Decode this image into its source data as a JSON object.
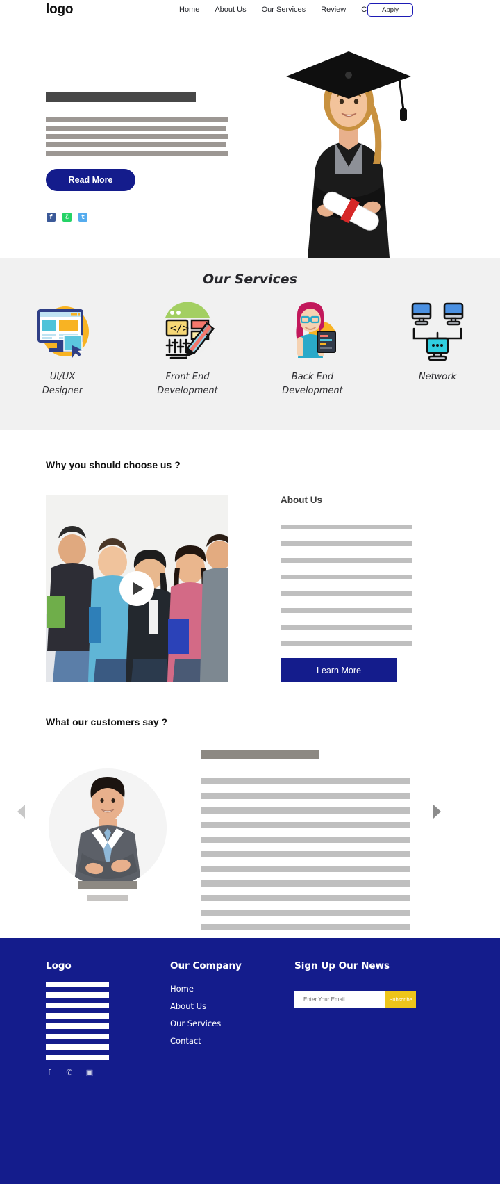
{
  "header": {
    "logo": "logo",
    "nav": [
      {
        "label": "Home",
        "name": "nav-home"
      },
      {
        "label": "About Us",
        "name": "nav-about-us"
      },
      {
        "label": "Our Services",
        "name": "nav-our-services"
      },
      {
        "label": "Review",
        "name": "nav-review"
      },
      {
        "label": "Contact",
        "name": "nav-contact"
      }
    ],
    "apply_label": "Apply"
  },
  "hero": {
    "read_more_label": "Read More",
    "title_bar_width": 216,
    "body_line_widths": [
      262,
      260,
      262,
      260,
      262
    ],
    "social": [
      {
        "name": "facebook-icon",
        "glyph": "f",
        "color": "#3b5998"
      },
      {
        "name": "whatsapp-icon",
        "glyph": "✆",
        "color": "#25d366"
      },
      {
        "name": "twitter-icon",
        "glyph": "t",
        "color": "#55acee"
      }
    ],
    "image_alt": "graduate-student-photo"
  },
  "services": {
    "title": "Our Services",
    "items": [
      {
        "label": "UI/UX\nDesigner",
        "icon": "ui-ux-design-icon"
      },
      {
        "label": "Front End\nDevelopment",
        "icon": "front-end-code-icon"
      },
      {
        "label": "Back End\nDevelopment",
        "icon": "back-end-developer-icon"
      },
      {
        "label": "Network",
        "icon": "network-computers-icon"
      }
    ]
  },
  "why": {
    "heading": "Why you should choose us ?",
    "video_alt": "group-of-students-photo",
    "play_icon": "play-icon"
  },
  "about": {
    "title": "About Us",
    "line_count": 8,
    "learn_more_label": "Learn More"
  },
  "testimonials": {
    "heading": "What our customers say ?",
    "avatar_alt": "businessman-portrait-photo",
    "quote_line_count": 11,
    "prev_icon": "chevron-left-icon",
    "next_icon": "chevron-right-icon"
  },
  "footer": {
    "logo_title": "Logo",
    "logo_bar_count": 8,
    "company_title": "Our Company",
    "company_links": [
      {
        "label": "Home",
        "name": "footer-link-home"
      },
      {
        "label": "About Us",
        "name": "footer-link-about-us"
      },
      {
        "label": "Our Services",
        "name": "footer-link-our-services"
      },
      {
        "label": "Contact",
        "name": "footer-link-contact"
      }
    ],
    "news_title": "Sign Up Our News",
    "email_placeholder": "Enter Your Email",
    "email_value": "",
    "subscribe_label": "Subscribe",
    "social": [
      {
        "name": "footer-facebook-icon",
        "glyph": "f"
      },
      {
        "name": "footer-whatsapp-icon",
        "glyph": "✆"
      },
      {
        "name": "footer-instagram-icon",
        "glyph": "▣"
      }
    ]
  },
  "colors": {
    "brand_blue": "#141c8c",
    "accent_yellow": "#eec51a",
    "section_grey": "#f1f1f1",
    "placeholder_grey": "#bfbfbf",
    "placeholder_dark": "#474747"
  }
}
